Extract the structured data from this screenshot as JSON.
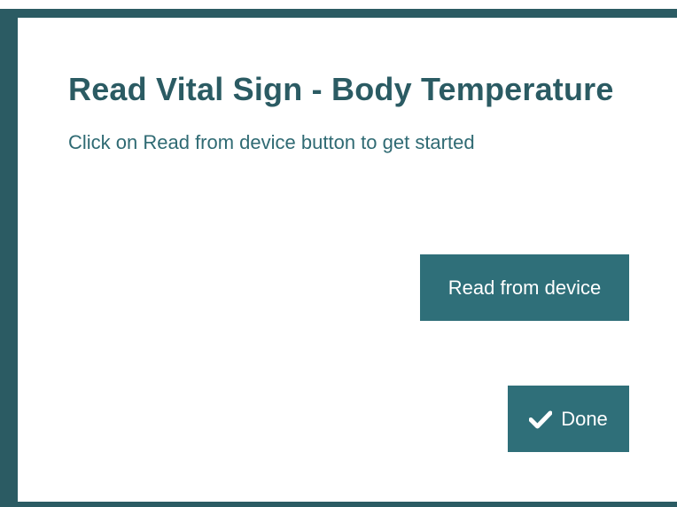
{
  "dialog": {
    "title": "Read Vital Sign - Body Temperature",
    "subtitle": "Click on Read from device button to get started"
  },
  "buttons": {
    "read_from_device": "Read from device",
    "done": "Done",
    "done_icon": "check-icon"
  },
  "colors": {
    "frame": "#2b5b63",
    "title": "#2b5b63",
    "button_bg": "#2f6f79",
    "button_text": "#ffffff"
  }
}
